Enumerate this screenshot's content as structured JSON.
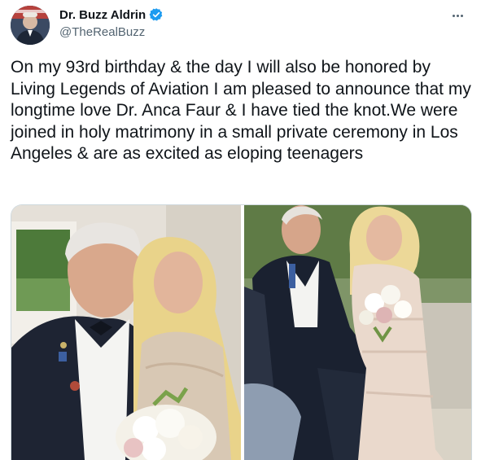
{
  "user": {
    "display_name": "Dr. Buzz Aldrin",
    "handle": "@TheRealBuzz",
    "verified": true,
    "avatar_icon": "user-avatar"
  },
  "tweet": {
    "text": "On my 93rd birthday & the day I will also be honored by Living Legends of Aviation I am pleased to announce that my longtime love Dr. Anca Faur & I have tied the knot.We were joined in holy matrimony in a small private ceremony in Los Angeles & are as excited as eloping teenagers"
  },
  "menu": {
    "icon": "more-horizontal-icon"
  },
  "colors": {
    "verified": "#1d9bf0",
    "secondary_text": "#536471",
    "text": "#0f1419"
  },
  "media": {
    "count": 2,
    "photos": [
      {
        "name": "wedding-photo-portrait"
      },
      {
        "name": "wedding-photo-ceremony"
      }
    ]
  }
}
